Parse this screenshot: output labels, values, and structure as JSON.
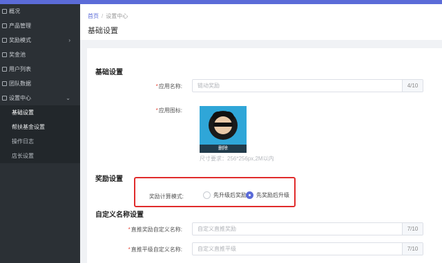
{
  "sidebar": {
    "items": [
      {
        "label": "概况"
      },
      {
        "label": "产品管理"
      },
      {
        "label": "奖励模式",
        "arrow": "›"
      },
      {
        "label": "奖金池"
      },
      {
        "label": "用户列表"
      },
      {
        "label": "团队数据"
      },
      {
        "label": "设置中心",
        "arrow": "⌄"
      }
    ],
    "subitems": [
      {
        "label": "基础设置"
      },
      {
        "label": "帮扶基金设置"
      },
      {
        "label": "操作日志"
      },
      {
        "label": "店长设置"
      }
    ]
  },
  "breadcrumb": {
    "home": "首页",
    "separator": "/",
    "current": "设置中心"
  },
  "page_title": "基础设置",
  "basic_section": {
    "title": "基础设置",
    "app_name_label": "应用名称:",
    "app_name_value": "链动奖励",
    "app_name_count": "4/10",
    "app_icon_label": "应用图标:",
    "delete_label": "删除",
    "size_hint": "尺寸要求：256*256px,2M以内"
  },
  "reward_section": {
    "title": "奖励设置",
    "mode_label": "奖励计算模式:",
    "option_1": "先升级后奖励",
    "option_2": "先奖励后升级",
    "selected": "先奖励后升级"
  },
  "custom_section": {
    "title": "自定义名称设置",
    "field_1_label": "直推奖励自定义名称:",
    "field_1_placeholder": "自定义直推奖励",
    "field_1_count": "7/10",
    "field_2_label": "直推平级自定义名称:",
    "field_2_placeholder": "自定义直推平级",
    "field_2_count": "7/10"
  },
  "colors": {
    "accent": "#5b6bd8",
    "sidebar": "#2b3035",
    "highlight": "#e02b2b",
    "required": "#e5483b"
  }
}
